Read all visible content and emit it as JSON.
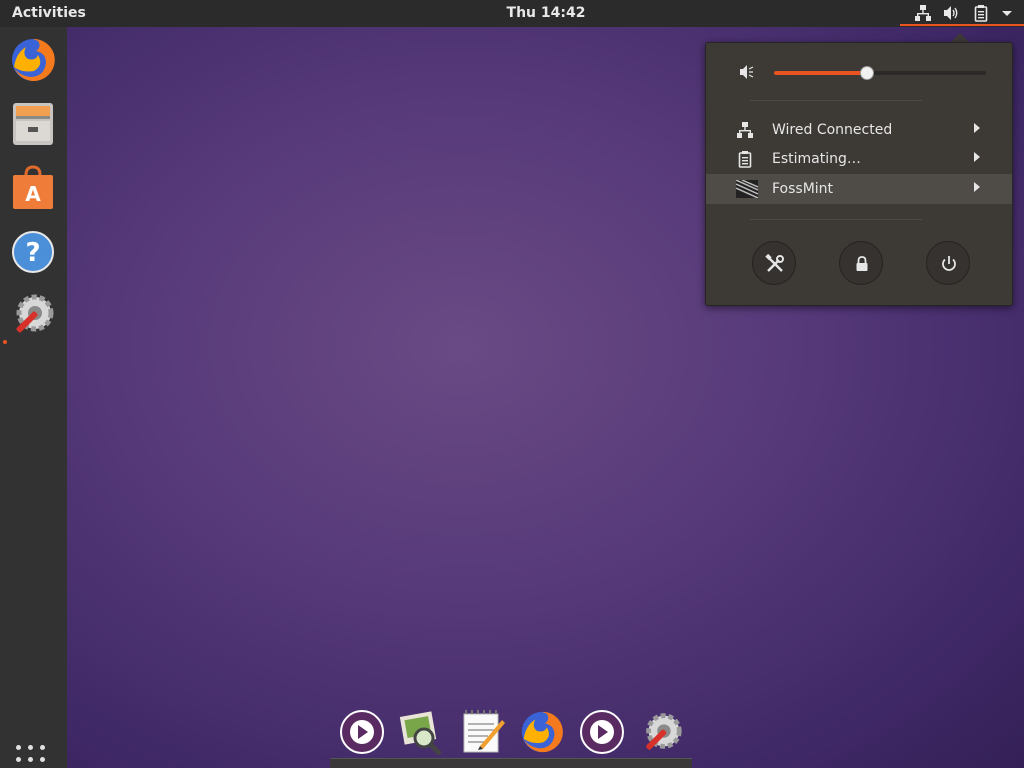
{
  "topbar": {
    "activities_label": "Activities",
    "clock": "Thu 14:42",
    "tray_icons": [
      "network-wired-icon",
      "volume-icon",
      "battery-icon",
      "dropdown-arrow-icon"
    ]
  },
  "dock": {
    "items": [
      {
        "name": "firefox",
        "icon": "firefox-icon"
      },
      {
        "name": "files",
        "icon": "file-cabinet-icon"
      },
      {
        "name": "software",
        "icon": "shopping-bag-icon"
      },
      {
        "name": "help",
        "icon": "help-icon"
      },
      {
        "name": "system-tools",
        "icon": "gear-wrench-icon",
        "running": true
      }
    ],
    "show_apps_icon": "apps-grid-icon"
  },
  "system_menu": {
    "volume": {
      "icon": "volume-low-icon",
      "level": 0.44
    },
    "items": [
      {
        "label": "Wired Connected",
        "icon": "network-wired-icon"
      },
      {
        "label": "Estimating…",
        "icon": "battery-icon"
      },
      {
        "label": "FossMint",
        "icon": "user-avatar-icon",
        "highlighted": true
      }
    ],
    "buttons": [
      {
        "name": "settings",
        "icon": "settings-tools-icon"
      },
      {
        "name": "lock",
        "icon": "lock-icon"
      },
      {
        "name": "power",
        "icon": "power-icon"
      }
    ]
  },
  "bottom_apps": [
    {
      "name": "media-player",
      "icon": "play-icon"
    },
    {
      "name": "image-viewer",
      "icon": "image-search-icon"
    },
    {
      "name": "text-editor",
      "icon": "notepad-pencil-icon"
    },
    {
      "name": "firefox",
      "icon": "firefox-icon"
    },
    {
      "name": "media-player-2",
      "icon": "play-icon"
    },
    {
      "name": "system-tools",
      "icon": "gear-wrench-icon"
    }
  ],
  "colors": {
    "accent": "#e95420",
    "topbar": "#2b2b2b",
    "dock": "#323232",
    "popup": "#3d3a36"
  }
}
